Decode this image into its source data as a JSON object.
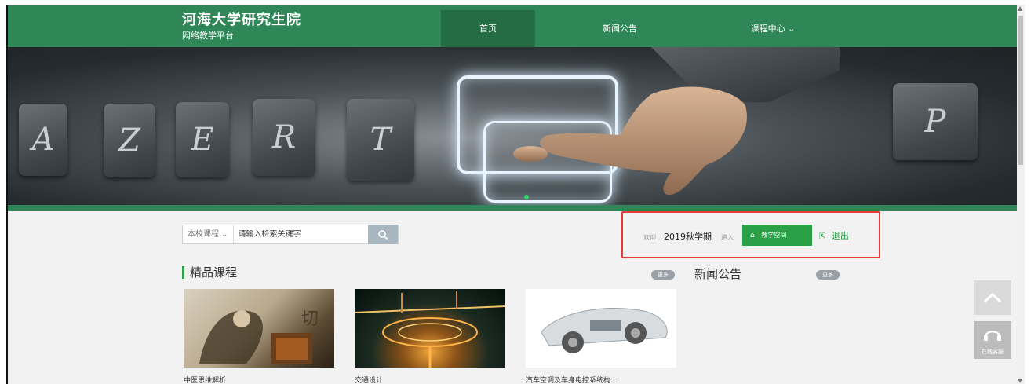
{
  "brand": {
    "title": "河海大学研究生院",
    "subtitle": "网络教学平台"
  },
  "nav": [
    {
      "label": "首页"
    },
    {
      "label": "新闻公告"
    },
    {
      "label": "课程中心 ⌄"
    }
  ],
  "banner": {
    "keys": [
      "A",
      "Z",
      "E",
      "R",
      "T",
      "P"
    ]
  },
  "search": {
    "scope": "本校课程 ⌄",
    "placeholder": "请输入检索关键字"
  },
  "user": {
    "welcome": "欢迎",
    "term": "2019秋学期",
    "enter": "进入",
    "space_button": "教学空间",
    "logout": "退出"
  },
  "sections": {
    "courses_title": "精品课程",
    "news_title": "新闻公告",
    "more": "更多"
  },
  "courses": [
    {
      "name": "中医思维解析"
    },
    {
      "name": "交通设计"
    },
    {
      "name": "汽车空调及车身电控系统构..."
    }
  ],
  "service": {
    "label": "在线客服"
  },
  "colors": {
    "primary_green": "#2f8656",
    "accent_green": "#2aa146",
    "highlight_red": "#e83a3a"
  }
}
